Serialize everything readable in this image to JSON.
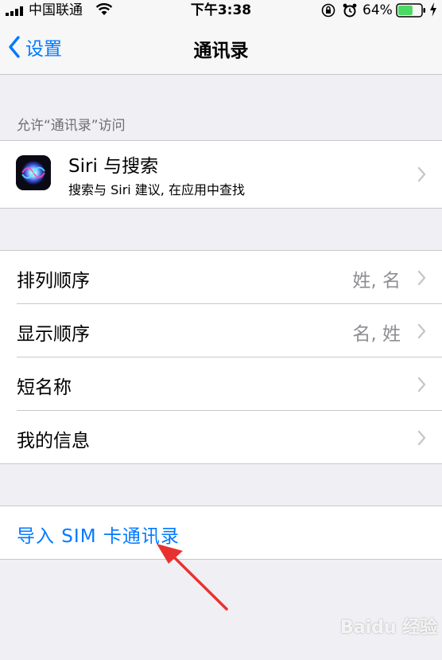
{
  "status_bar": {
    "carrier": "中国联通",
    "time": "下午3:38",
    "battery_percent": "64%",
    "battery_level": 0.64,
    "colors": {
      "battery": "#4cd964"
    }
  },
  "nav": {
    "back_label": "设置",
    "title": "通讯录",
    "colors": {
      "accent": "#007aff"
    }
  },
  "section_header": "允许“通讯录”访问",
  "siri_row": {
    "title": "Siri 与搜索",
    "subtitle": "搜索与 Siri 建议, 在应用中查找",
    "icon": "siri-icon"
  },
  "settings": [
    {
      "label": "排列顺序",
      "value": "姓, 名"
    },
    {
      "label": "显示顺序",
      "value": "名, 姓"
    },
    {
      "label": "短名称",
      "value": ""
    },
    {
      "label": "我的信息",
      "value": ""
    }
  ],
  "import_row": {
    "label": "导入 SIM 卡通讯录"
  },
  "annotation": {
    "arrow_color": "#e8322f"
  },
  "watermark": {
    "text": "Baidu 经验"
  }
}
